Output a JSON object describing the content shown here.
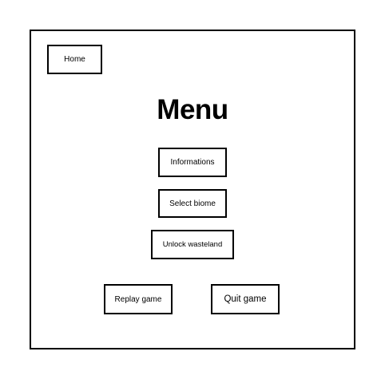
{
  "menu": {
    "title": "Menu",
    "home_label": "Home",
    "informations_label": "Informations",
    "select_biome_label": "Select biome",
    "unlock_wasteland_label": "Unlock wasteland",
    "replay_label": "Replay game",
    "quit_label": "Quit game"
  },
  "colors": {
    "background": "#ffffff",
    "border": "#000000",
    "text": "#000000"
  }
}
